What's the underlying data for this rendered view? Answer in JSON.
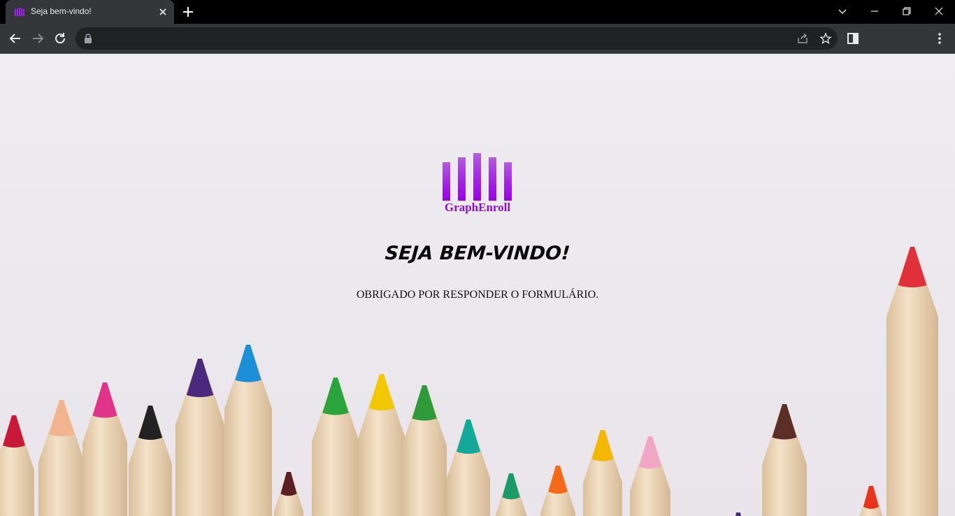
{
  "browser": {
    "tab_title": "Seja bem-vindo!",
    "url": "",
    "icons": [
      "favicon-icon",
      "close-icon",
      "plus-icon",
      "chevron-down-icon",
      "minimize-icon",
      "restore-icon",
      "close-window-icon",
      "back-icon",
      "forward-icon",
      "reload-icon",
      "lock-icon",
      "share-icon",
      "star-icon",
      "side-panel-icon",
      "kebab-menu-icon"
    ]
  },
  "page": {
    "logo_text": "GraphEnroll",
    "heading": "SEJA BEM-VINDO!",
    "message": "OBRIGADO POR RESPONDER O FORMULÁRIO."
  },
  "colors": {
    "brand_purple": "#8a10cc",
    "background": "#edeaef"
  }
}
